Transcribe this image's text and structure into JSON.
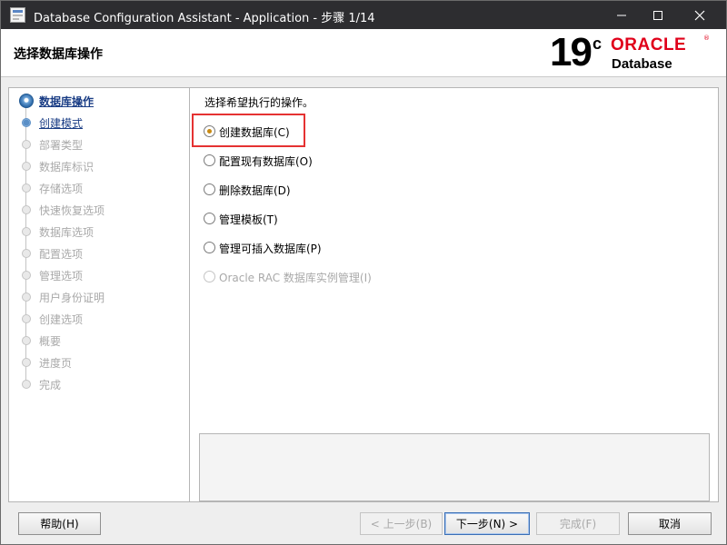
{
  "window": {
    "title": "Database Configuration Assistant - Application - 步骤 1/14"
  },
  "header": {
    "page_title": "选择数据库操作",
    "logo_version": "19",
    "logo_superscript": "c",
    "logo_brand": "ORACLE",
    "logo_registered": "®",
    "logo_product": "Database"
  },
  "nav": {
    "items": [
      {
        "label": "数据库操作",
        "state": "current"
      },
      {
        "label": "创建模式",
        "state": "next"
      },
      {
        "label": "部署类型",
        "state": "disabled"
      },
      {
        "label": "数据库标识",
        "state": "disabled"
      },
      {
        "label": "存储选项",
        "state": "disabled"
      },
      {
        "label": "快速恢复选项",
        "state": "disabled"
      },
      {
        "label": "数据库选项",
        "state": "disabled"
      },
      {
        "label": "配置选项",
        "state": "disabled"
      },
      {
        "label": "管理选项",
        "state": "disabled"
      },
      {
        "label": "用户身份证明",
        "state": "disabled"
      },
      {
        "label": "创建选项",
        "state": "disabled"
      },
      {
        "label": "概要",
        "state": "disabled"
      },
      {
        "label": "进度页",
        "state": "disabled"
      },
      {
        "label": "完成",
        "state": "disabled"
      }
    ]
  },
  "main": {
    "prompt": "选择希望执行的操作。",
    "options": [
      {
        "label": "创建数据库(C)",
        "selected": true,
        "enabled": true
      },
      {
        "label": "配置现有数据库(O)",
        "selected": false,
        "enabled": true
      },
      {
        "label": "删除数据库(D)",
        "selected": false,
        "enabled": true
      },
      {
        "label": "管理模板(T)",
        "selected": false,
        "enabled": true
      },
      {
        "label": "管理可插入数据库(P)",
        "selected": false,
        "enabled": true
      },
      {
        "label": "Oracle RAC 数据库实例管理(I)",
        "selected": false,
        "enabled": false
      }
    ]
  },
  "buttons": {
    "help": "帮助(H)",
    "back": "< 上一步(B)",
    "next": "下一步(N) >",
    "finish": "完成(F)",
    "cancel": "取消"
  },
  "colors": {
    "titlebar": "#2d2d30",
    "oracle_red": "#e0001a",
    "nav_active": "#1a3d85",
    "highlight": "#e53232"
  }
}
